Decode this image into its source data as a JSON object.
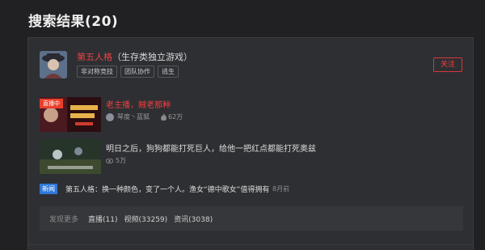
{
  "page": {
    "title": "搜索结果(20)"
  },
  "game": {
    "name": "第五人格",
    "subtitle": "（生存类独立游戏）",
    "tags": [
      "非对称竞技",
      "团队协作",
      "逃生"
    ],
    "follow_label": "关注"
  },
  "live": {
    "badge": "直播中",
    "title": "老主播，贼老那种",
    "streamer": "琴度丶蓝狐",
    "views": "62万"
  },
  "video": {
    "title": "明日之后，狗狗都能打死巨人，给他一把红点都能打死奥兹",
    "views": "5万"
  },
  "news": {
    "badge": "新闻",
    "title": "第五人格：换一种颜色，变了一个人。渔女“德中歌女”值得拥有",
    "time": "8月前"
  },
  "discover": {
    "label": "发现更多",
    "links": [
      "直播(11)",
      "视频(33259)",
      "资讯(3038)"
    ]
  },
  "colors": {
    "background": "#212124",
    "card": "#2e2f33",
    "accent_red": "#ee4042",
    "news_blue": "#2f78d7",
    "live_badge": "#e9402b"
  }
}
